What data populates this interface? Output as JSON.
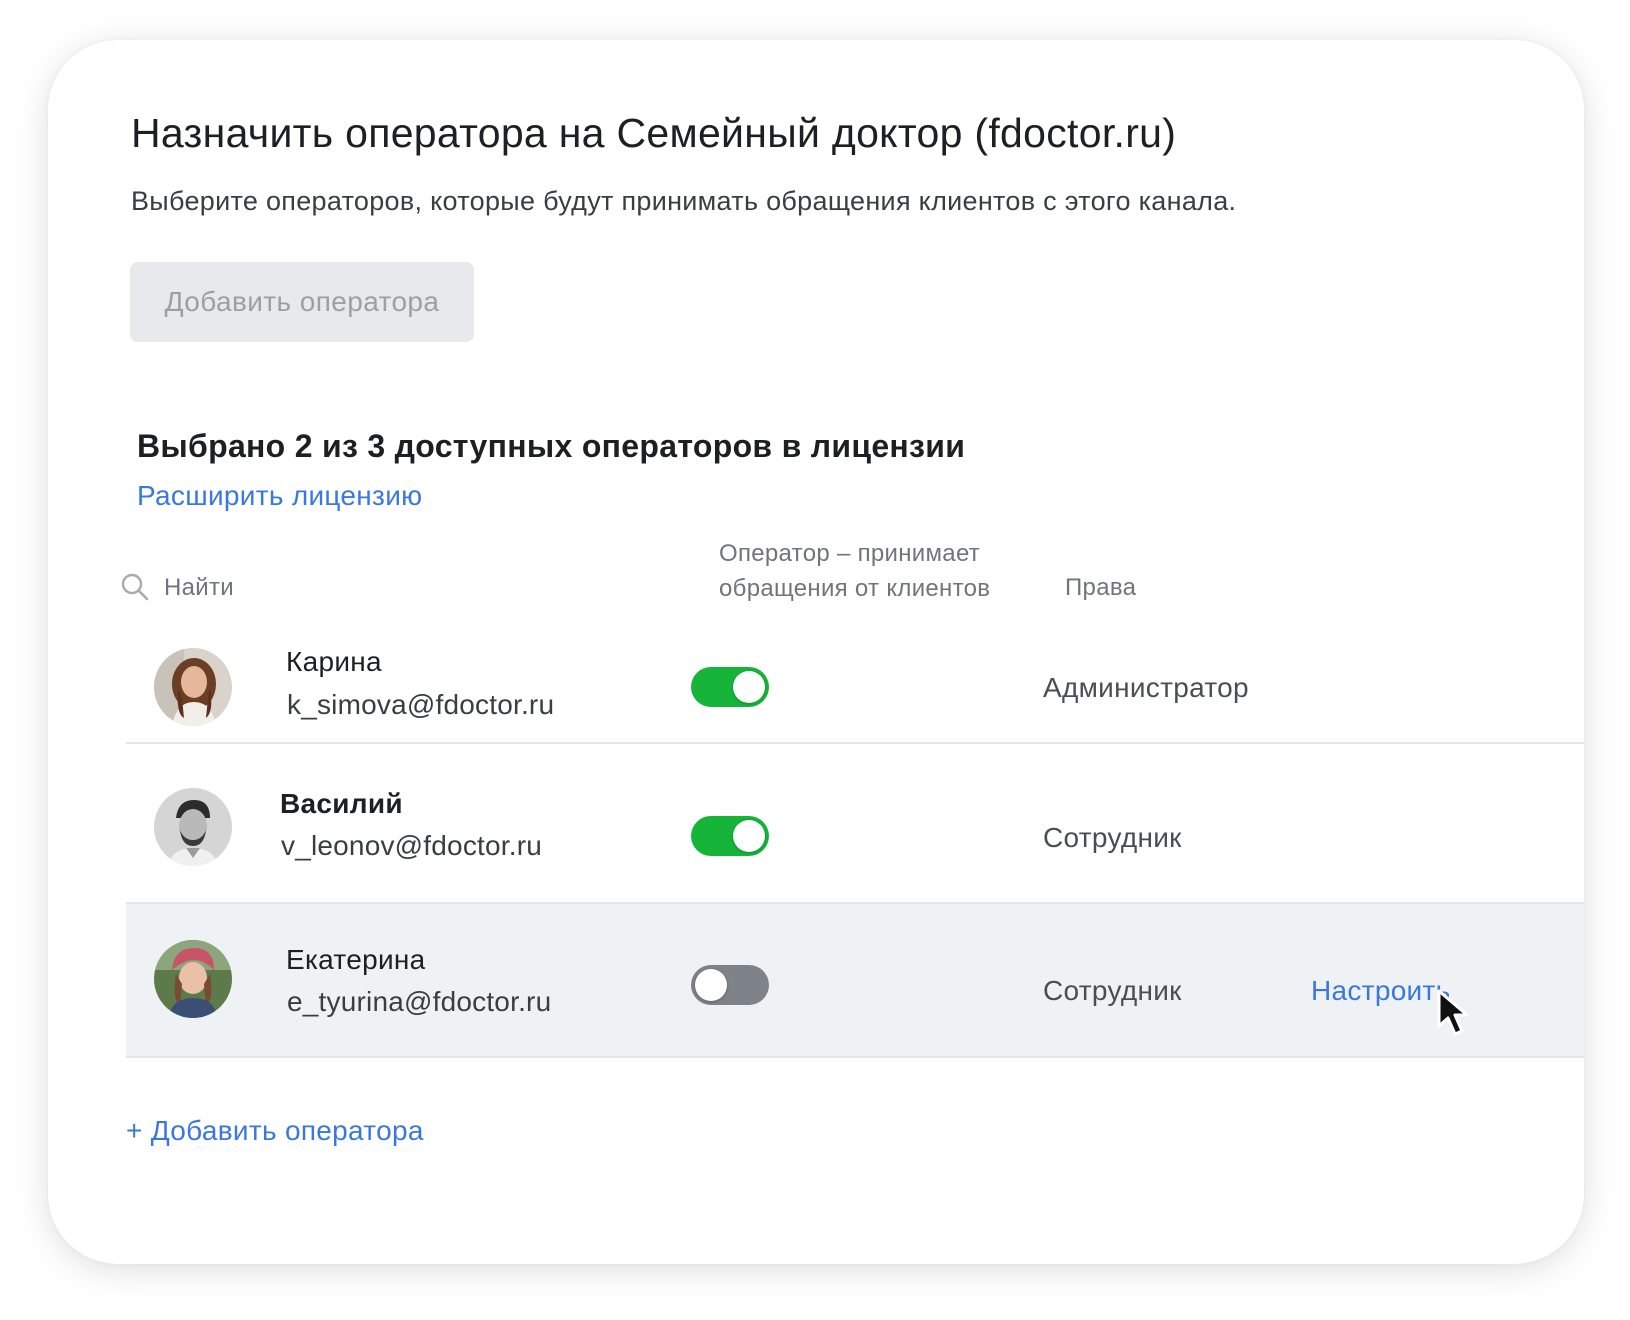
{
  "dialog": {
    "title": "Назначить оператора на Семейный доктор (fdoctor.ru)",
    "subtitle": "Выберите операторов, которые будут принимать обращения клиентов с этого канала.",
    "add_button_label": "Добавить оператора"
  },
  "license": {
    "summary": "Выбрано 2 из 3 доступных операторов в лицензии",
    "expand_link": "Расширить лицензию"
  },
  "table": {
    "search_placeholder": "Найти",
    "col_operator_line1": "Оператор – принимает",
    "col_operator_line2": "обращения от клиентов",
    "col_rights": "Права"
  },
  "operators": [
    {
      "name": "Карина",
      "email": "k_simova@fdoctor.ru",
      "accepts_requests": true,
      "rights": "Администратор"
    },
    {
      "name": "Василий",
      "email": "v_leonov@fdoctor.ru",
      "accepts_requests": true,
      "rights": "Сотрудник"
    },
    {
      "name": "Екатерина",
      "email": "e_tyurina@fdoctor.ru",
      "accepts_requests": false,
      "rights": "Сотрудник",
      "action_link": "Настроить"
    }
  ],
  "footer": {
    "add_operator_link": "+ Добавить оператора"
  },
  "colors": {
    "toggle_on": "#16b53a",
    "toggle_off": "#7e8389",
    "link": "#3a78dd",
    "row_highlight": "#eff2f5"
  }
}
